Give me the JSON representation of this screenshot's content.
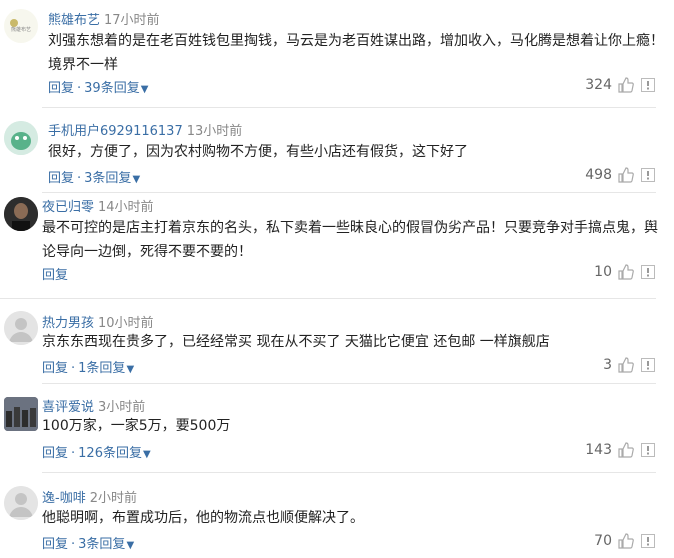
{
  "comments": [
    {
      "user": "熊雄布艺",
      "time": "17小时前",
      "text": "刘强东想着的是在老百姓钱包里掏钱，马云是为老百姓谋出路，增加收入，马化腾是想着让你上瘾！境界不一样",
      "reply": "回复",
      "replies": "39条回复",
      "likes": "324",
      "avatar_text": "熊雄布艺"
    },
    {
      "user": "手机用户6929116137",
      "time": "13小时前",
      "text": "很好，方便了，因为农村购物不方便，有些小店还有假货，这下好了",
      "reply": "回复",
      "replies": "3条回复",
      "likes": "498"
    },
    {
      "user": "夜已归零",
      "time": "14小时前",
      "text": "最不可控的是店主打着京东的名头，私下卖着一些昧良心的假冒伪劣产品！只要竞争对手搞点鬼，舆论导向一边倒，死得不要不要的！",
      "reply": "回复",
      "likes": "10"
    },
    {
      "user": "热力男孩",
      "time": "10小时前",
      "text": "京东东西现在贵多了，已经经常买 现在从不买了 天猫比它便宜 还包邮 一样旗舰店",
      "reply": "回复",
      "replies": "1条回复",
      "likes": "3"
    },
    {
      "user": "喜评爱说",
      "time": "3小时前",
      "text": "100万家，一家5万，要500万",
      "reply": "回复",
      "replies": "126条回复",
      "likes": "143"
    },
    {
      "user": "逸-咖啡",
      "time": "2小时前",
      "text": "他聪明啊，布置成功后，他的物流点也顺便解决了。",
      "reply": "回复",
      "replies": "3条回复",
      "likes": "70"
    }
  ],
  "colors": {
    "username": "#3a6ea5",
    "time": "#888888",
    "text": "#222222",
    "divider": "#e6e6e6"
  }
}
